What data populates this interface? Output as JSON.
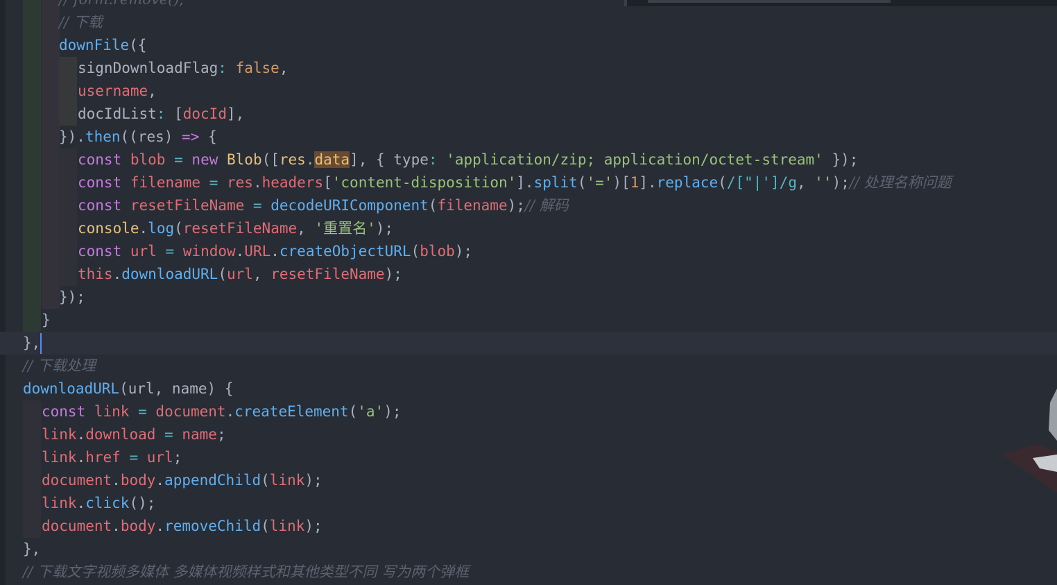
{
  "editor": {
    "colors": {
      "background": "#282c34",
      "comment": "#5c6370",
      "function": "#61afef",
      "keyword": "#c678dd",
      "variable": "#e06c75",
      "string": "#98c379",
      "number": "#d19a66",
      "class": "#e5c07b",
      "text": "#abb2bf",
      "cursor": "#528bff"
    },
    "active_line": 15,
    "lines": [
      [
        [
          "cm",
          "// form.remove();"
        ]
      ],
      [
        [
          "cm",
          "// 下载"
        ]
      ],
      [
        [
          "fn",
          "downFile"
        ],
        [
          "txt",
          "({"
        ]
      ],
      [
        [
          "txt",
          "signDownloadFlag"
        ],
        [
          "op",
          ":"
        ],
        [
          "txt",
          " "
        ],
        [
          "bool",
          "false"
        ],
        [
          "txt",
          ","
        ]
      ],
      [
        [
          "var",
          "username"
        ],
        [
          "txt",
          ","
        ]
      ],
      [
        [
          "txt",
          "docIdList"
        ],
        [
          "op",
          ":"
        ],
        [
          "txt",
          " ["
        ],
        [
          "var",
          "docId"
        ],
        [
          "txt",
          "],"
        ]
      ],
      [
        [
          "txt",
          "})."
        ],
        [
          "fn",
          "then"
        ],
        [
          "txt",
          "(("
        ],
        [
          "txt",
          "res"
        ],
        [
          "txt",
          ") "
        ],
        [
          "kw",
          "=>"
        ],
        [
          "txt",
          " {"
        ]
      ],
      [
        [
          "kw",
          "const"
        ],
        [
          "txt",
          " "
        ],
        [
          "var",
          "blob"
        ],
        [
          "txt",
          " "
        ],
        [
          "op",
          "="
        ],
        [
          "txt",
          " "
        ],
        [
          "kw",
          "new"
        ],
        [
          "txt",
          " "
        ],
        [
          "cls",
          "Blob"
        ],
        [
          "txt",
          "(["
        ],
        [
          "cls",
          "res"
        ],
        [
          "txt",
          "."
        ],
        [
          "hl",
          "data"
        ],
        [
          "txt",
          "], { type"
        ],
        [
          "op",
          ":"
        ],
        [
          "txt",
          " "
        ],
        [
          "str",
          "'application/zip; application/octet-stream'"
        ],
        [
          "txt",
          " });"
        ]
      ],
      [
        [
          "kw",
          "const"
        ],
        [
          "txt",
          " "
        ],
        [
          "var",
          "filename"
        ],
        [
          "txt",
          " "
        ],
        [
          "op",
          "="
        ],
        [
          "txt",
          " "
        ],
        [
          "var",
          "res"
        ],
        [
          "txt",
          "."
        ],
        [
          "var",
          "headers"
        ],
        [
          "txt",
          "["
        ],
        [
          "str",
          "'content-disposition'"
        ],
        [
          "txt",
          "]."
        ],
        [
          "fn",
          "split"
        ],
        [
          "txt",
          "("
        ],
        [
          "str",
          "'='"
        ],
        [
          "txt",
          ")["
        ],
        [
          "num",
          "1"
        ],
        [
          "txt",
          "]."
        ],
        [
          "fn",
          "replace"
        ],
        [
          "txt",
          "("
        ],
        [
          "op",
          "/[\"|']/g"
        ],
        [
          "txt",
          ", "
        ],
        [
          "str",
          "''"
        ],
        [
          "txt",
          ");"
        ],
        [
          "cm",
          "// 处理名称问题"
        ]
      ],
      [
        [
          "kw",
          "const"
        ],
        [
          "txt",
          " "
        ],
        [
          "var",
          "resetFileName"
        ],
        [
          "txt",
          " "
        ],
        [
          "op",
          "="
        ],
        [
          "txt",
          " "
        ],
        [
          "fn",
          "decodeURIComponent"
        ],
        [
          "txt",
          "("
        ],
        [
          "var",
          "filename"
        ],
        [
          "txt",
          ");"
        ],
        [
          "cm",
          "// 解码"
        ]
      ],
      [
        [
          "cls",
          "console"
        ],
        [
          "txt",
          "."
        ],
        [
          "fn",
          "log"
        ],
        [
          "txt",
          "("
        ],
        [
          "var",
          "resetFileName"
        ],
        [
          "txt",
          ", "
        ],
        [
          "str",
          "'重置名'"
        ],
        [
          "txt",
          ");"
        ]
      ],
      [
        [
          "kw",
          "const"
        ],
        [
          "txt",
          " "
        ],
        [
          "var",
          "url"
        ],
        [
          "txt",
          " "
        ],
        [
          "op",
          "="
        ],
        [
          "txt",
          " "
        ],
        [
          "var",
          "window"
        ],
        [
          "txt",
          "."
        ],
        [
          "var",
          "URL"
        ],
        [
          "txt",
          "."
        ],
        [
          "fn",
          "createObjectURL"
        ],
        [
          "txt",
          "("
        ],
        [
          "var",
          "blob"
        ],
        [
          "txt",
          ");"
        ]
      ],
      [
        [
          "var",
          "this"
        ],
        [
          "txt",
          "."
        ],
        [
          "fn",
          "downloadURL"
        ],
        [
          "txt",
          "("
        ],
        [
          "var",
          "url"
        ],
        [
          "txt",
          ", "
        ],
        [
          "var",
          "resetFileName"
        ],
        [
          "txt",
          ");"
        ]
      ],
      [
        [
          "txt",
          "});"
        ]
      ],
      [
        [
          "txt",
          "}"
        ]
      ],
      [
        [
          "txt",
          "},"
        ]
      ],
      [
        [
          "cm",
          "// 下载处理"
        ]
      ],
      [
        [
          "fn",
          "downloadURL"
        ],
        [
          "txt",
          "(url, name) {"
        ]
      ],
      [
        [
          "kw",
          "const"
        ],
        [
          "txt",
          " "
        ],
        [
          "var",
          "link"
        ],
        [
          "txt",
          " "
        ],
        [
          "op",
          "="
        ],
        [
          "txt",
          " "
        ],
        [
          "var",
          "document"
        ],
        [
          "txt",
          "."
        ],
        [
          "fn",
          "createElement"
        ],
        [
          "txt",
          "("
        ],
        [
          "str",
          "'a'"
        ],
        [
          "txt",
          ");"
        ]
      ],
      [
        [
          "var",
          "link"
        ],
        [
          "txt",
          "."
        ],
        [
          "var",
          "download"
        ],
        [
          "txt",
          " "
        ],
        [
          "op",
          "="
        ],
        [
          "txt",
          " "
        ],
        [
          "var",
          "name"
        ],
        [
          "txt",
          ";"
        ]
      ],
      [
        [
          "var",
          "link"
        ],
        [
          "txt",
          "."
        ],
        [
          "var",
          "href"
        ],
        [
          "txt",
          " "
        ],
        [
          "op",
          "="
        ],
        [
          "txt",
          " "
        ],
        [
          "var",
          "url"
        ],
        [
          "txt",
          ";"
        ]
      ],
      [
        [
          "var",
          "document"
        ],
        [
          "txt",
          "."
        ],
        [
          "var",
          "body"
        ],
        [
          "txt",
          "."
        ],
        [
          "fn",
          "appendChild"
        ],
        [
          "txt",
          "("
        ],
        [
          "var",
          "link"
        ],
        [
          "txt",
          ");"
        ]
      ],
      [
        [
          "var",
          "link"
        ],
        [
          "txt",
          "."
        ],
        [
          "fn",
          "click"
        ],
        [
          "txt",
          "();"
        ]
      ],
      [
        [
          "var",
          "document"
        ],
        [
          "txt",
          "."
        ],
        [
          "var",
          "body"
        ],
        [
          "txt",
          "."
        ],
        [
          "fn",
          "removeChild"
        ],
        [
          "txt",
          "("
        ],
        [
          "var",
          "link"
        ],
        [
          "txt",
          ");"
        ]
      ],
      [
        [
          "txt",
          "},"
        ]
      ],
      [
        [
          "cm",
          "// 下载文字视频多媒体 多媒体视频样式和其他类型不同 写为两个弹框"
        ]
      ]
    ]
  }
}
